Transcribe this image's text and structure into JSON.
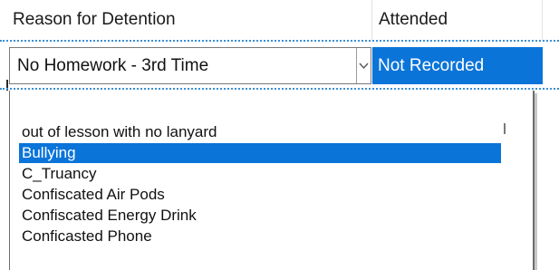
{
  "grid": {
    "columns": [
      {
        "label": "Reason for Detention"
      },
      {
        "label": "Attended"
      }
    ]
  },
  "row": {
    "reason_value": "No Homework - 3rd Time",
    "attended_value": "Not Recorded"
  },
  "dropdown": {
    "items": [
      {
        "label": "out of lesson with no lanyard",
        "selected": false
      },
      {
        "label": "Bullying",
        "selected": true
      },
      {
        "label": "C_Truancy",
        "selected": false
      },
      {
        "label": "Confiscated Air Pods",
        "selected": false
      },
      {
        "label": "Confiscated Energy Drink",
        "selected": false
      },
      {
        "label": "Conficasted Phone",
        "selected": false
      }
    ]
  },
  "colors": {
    "selection": "#0a74d9",
    "grid_dots": "#3a8fd6"
  }
}
